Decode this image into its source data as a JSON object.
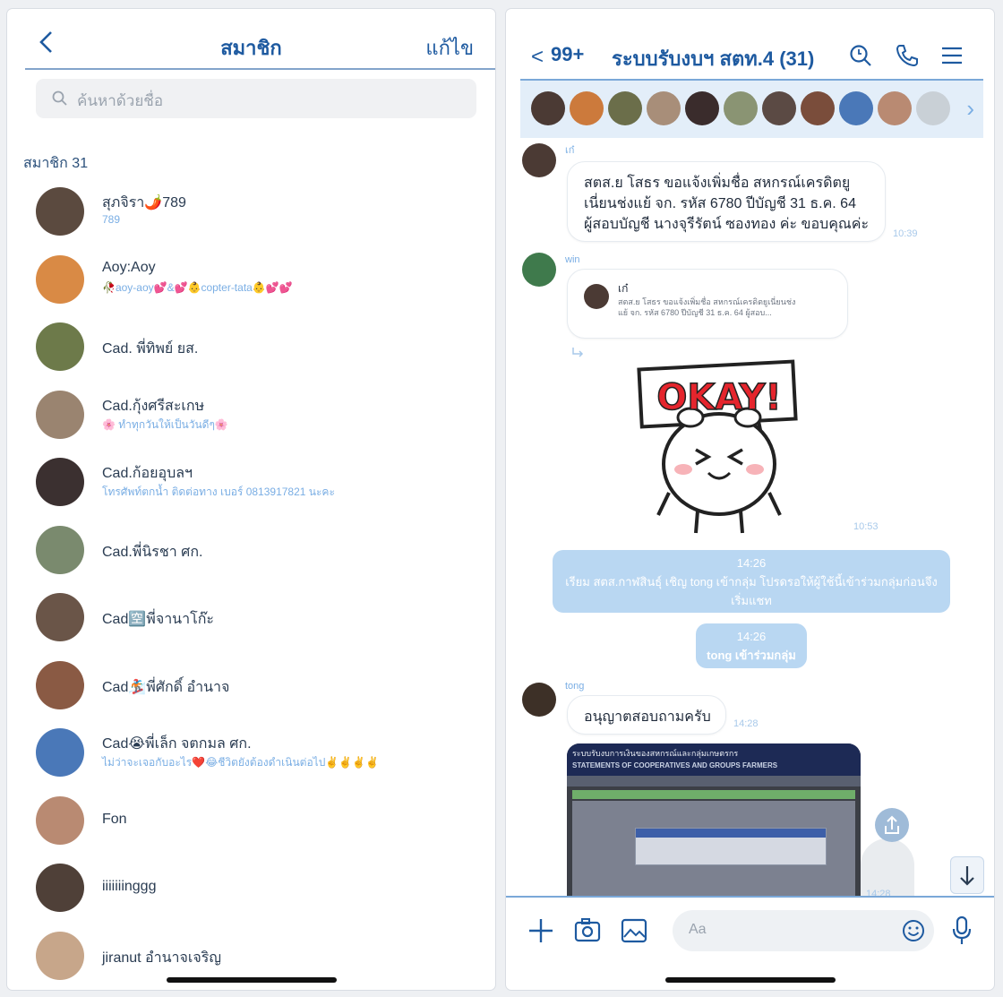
{
  "left": {
    "back_icon": "chevron-left-icon",
    "title": "สมาชิก",
    "edit": "แก้ไข",
    "search_placeholder": "ค้นหาด้วยชื่อ",
    "section": "สมาชิก 31",
    "members": [
      {
        "name": "สุภจิรา🌶️789",
        "status": "789",
        "color": "#5b4a3f"
      },
      {
        "name": "Aoy:Aoy",
        "status": "🥀aoy-aoy💕&💕👶copter-tata👶💕💕",
        "color": "#d98a45"
      },
      {
        "name": "Cad. พี่ทิพย์ ยส.",
        "status": "",
        "color": "#6d7a4a"
      },
      {
        "name": "Cad.กุ้งศรีสะเกษ",
        "status": "🌸 ทำทุกวันให้เป็นวันดีๆ🌸",
        "color": "#9a8470"
      },
      {
        "name": "Cad.ก้อยอุบลฯ",
        "status": "โทรศัพท์ตกน้ำ ติดต่อทาง เบอร์ 0813917821 นะคะ",
        "color": "#3b3030"
      },
      {
        "name": "Cad.พี่นิรชา ศก.",
        "status": "",
        "color": "#7a8a6e"
      },
      {
        "name": "Cad🈳พี่จานาโก๊ะ",
        "status": "",
        "color": "#6a5548"
      },
      {
        "name": "Cad🏂พี่ศักดิ์ อำนาจ",
        "status": "",
        "color": "#8a5a44"
      },
      {
        "name": "Cad😭พี่เล็ก จตกมล ศก.",
        "status": "ไม่ว่าจะเจอกับอะไร❤️😂ชีวิตยังต้องดำเนินต่อไป✌️✌️✌️✌️",
        "color": "#4a78b8"
      },
      {
        "name": "Fon",
        "status": "",
        "color": "#b98a72"
      },
      {
        "name": "iiiiiiinggg",
        "status": "",
        "color": "#4f4038"
      },
      {
        "name": "jiranut อำนาจเจริญ",
        "status": "",
        "color": "#c7a68a"
      }
    ]
  },
  "right": {
    "back_icon": "chevron-left-icon",
    "unread": "99+",
    "title": "ระบบรับงบฯ สตท.4 (31)",
    "header_icons": [
      "search-icon",
      "phone-icon",
      "menu-icon"
    ],
    "strip_colors": [
      "#4b3a34",
      "#cc7a3c",
      "#6b6e4a",
      "#a88e79",
      "#3a2c2c",
      "#8a9473",
      "#5b4a44",
      "#7a4d3b",
      "#4a78b8",
      "#b98a72",
      "#c9d0d6"
    ],
    "messages": {
      "m1_sender": "เก๋",
      "m1_lines": [
        "สตส.ย โสธร ขอแจ้งเพิ่มชื่อ สหกรณ์เครดิตยู",
        "เนี่ยนช่งแย้  จก. รหัส 6780 ปีบัญชี 31 ธ.ค. 64",
        "ผู้สอบบัญชี นางจุรีรัตน์  ซองทอง ค่ะ ขอบคุณค่ะ"
      ],
      "m1_time": "10:39",
      "m2_sender": "win",
      "m2_reply_name": "เก๋",
      "m2_reply_text1": "สตส.ย โสธร ขอแจ้งเพิ่มชื่อ สหกรณ์เครดิตยูเนี่ยนช่ง",
      "m2_reply_text2": "แย้ จก. รหัส 6780 ปีบัญชี 31 ธ.ค. 64 ผู้สอบ...",
      "sticker_text": "OKAY!",
      "m2_time": "10:53",
      "sys1_time": "14:26",
      "sys1_text_a": "เรียม สตส.กาฬสินธุ์ เชิญ tong เข้ากลุ่ม โปรดรอให้ผู้ใช้นี้เข้าร่วมกลุ่มก่อนจึง",
      "sys1_text_b": "เริ่มแชท",
      "sys2_time": "14:26",
      "sys2_text": "tong เข้าร่วมกลุ่ม",
      "m3_sender": "tong",
      "m3_text": "อนุญาตสอบถามครับ",
      "m3_time": "14:28",
      "photo_header": "ระบบรับงบการเงินของสหกรณ์และกลุ่มเกษตรกร",
      "photo_sub": "STATEMENTS OF COOPERATIVES AND GROUPS FARMERS",
      "photo_time": "14:28"
    },
    "footer": {
      "placeholder": "Aa",
      "icons": [
        "plus-icon",
        "camera-icon",
        "image-icon",
        "emoji-icon",
        "mic-icon"
      ]
    }
  }
}
